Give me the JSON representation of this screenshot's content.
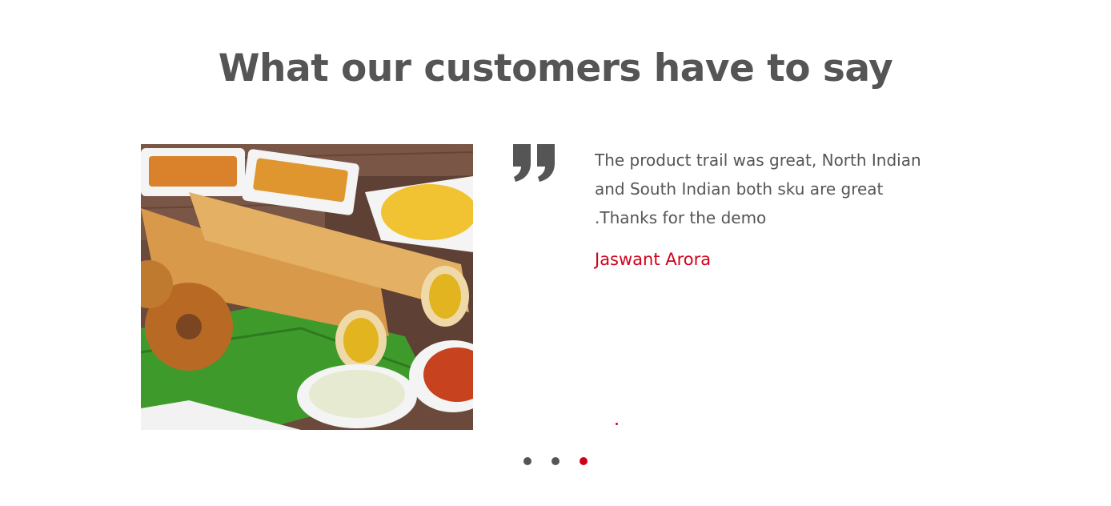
{
  "testimonials": {
    "heading": "What our customers have to say",
    "quote": "The product trail was great, North Indian and South Indian both sku are great .Thanks for the demo",
    "author": "Jaswant Arora",
    "active_slide": 3,
    "slide_count": 3
  },
  "colors": {
    "heading": "#555555",
    "text": "#555555",
    "accent": "#d0021b",
    "dot_inactive": "#555555"
  },
  "icons": {
    "quote": "closing-quote-icon"
  }
}
